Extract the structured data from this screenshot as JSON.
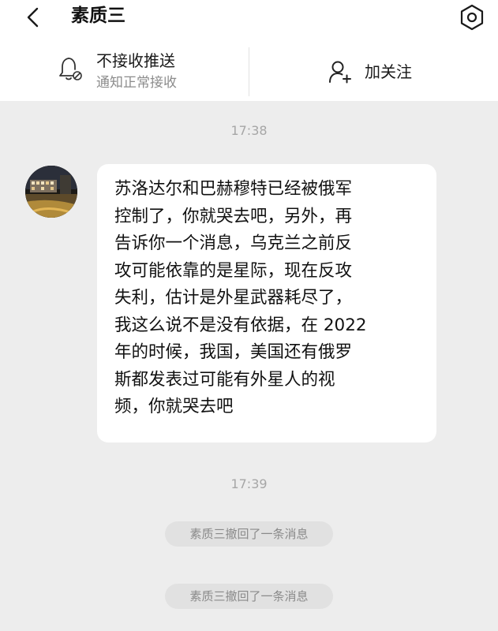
{
  "header": {
    "title": "素质三"
  },
  "actions": {
    "push_title": "不接收推送",
    "push_subtitle": "通知正常接收",
    "follow_label": "加关注"
  },
  "chat": {
    "timestamp_1": "17:38",
    "message_text": "苏洛达尔和巴赫穆特已经被俄军\n控制了，你就哭去吧，另外，再\n告诉你一个消息，乌克兰之前反\n攻可能依靠的是星际，现在反攻\n失利，估计是外星武器耗尽了，\n我这么说不是没有依据，在 2022\n年的时候，我国，美国还有俄罗\n斯都发表过可能有外星人的视\n频，你就哭去吧",
    "timestamp_2": "17:39",
    "recall_notices": [
      "素质三撤回了一条消息",
      "素质三撤回了一条消息"
    ]
  },
  "icons": {
    "back": "chevron-left-icon",
    "settings": "hexagon-gear-icon",
    "mute": "bell-off-icon",
    "follow": "user-plus-icon"
  }
}
